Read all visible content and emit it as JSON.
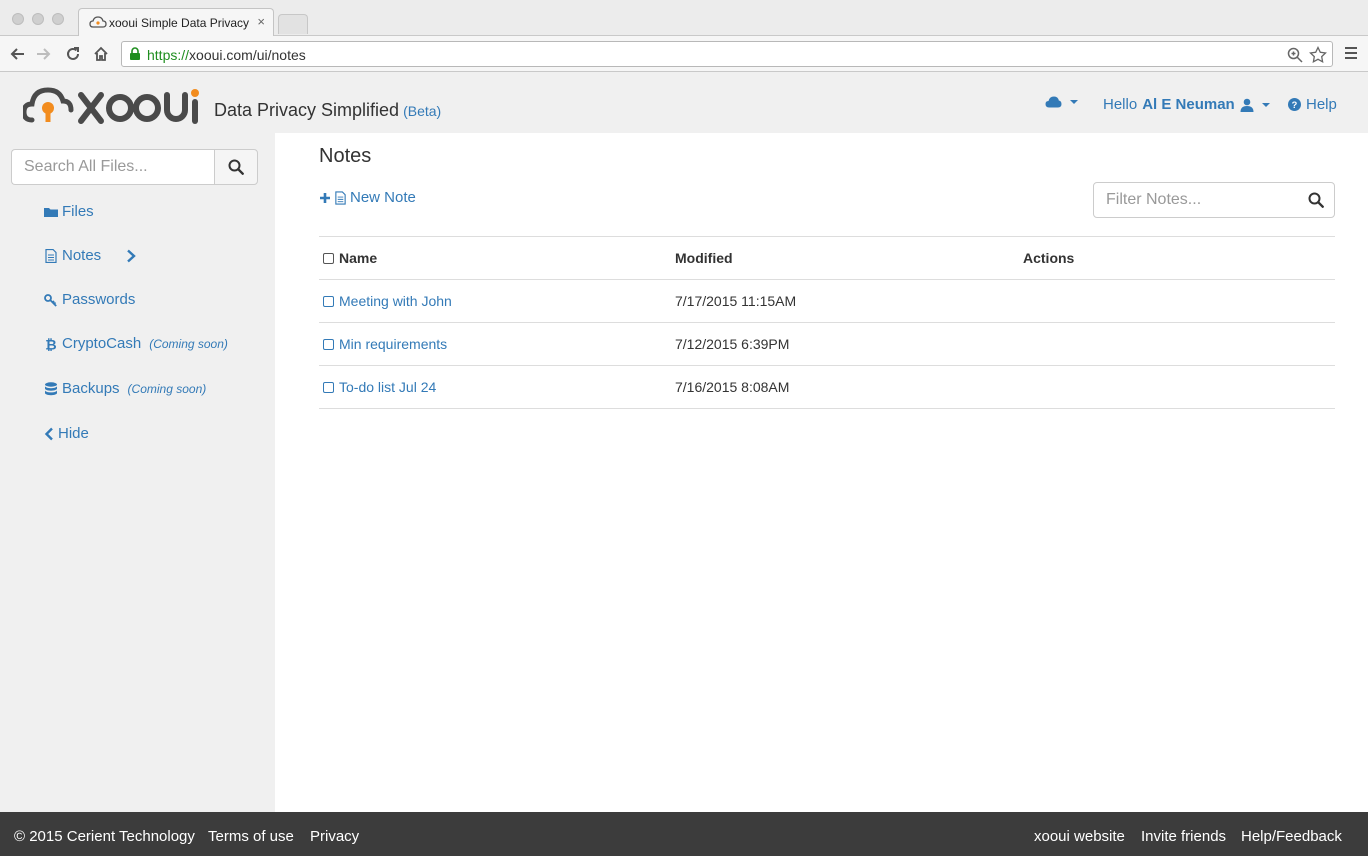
{
  "browser": {
    "tab_title": "xooui Simple Data Privacy",
    "tab_close": "×",
    "url_scheme": "https://",
    "url_rest": "xooui.com/ui/notes"
  },
  "header": {
    "tagline": "Data Privacy Simplified",
    "beta": "(Beta)",
    "greeting": "Hello",
    "user_name": "Al E Neuman",
    "help": "Help"
  },
  "sidebar": {
    "search_placeholder": "Search All Files...",
    "items": [
      {
        "label": "Files",
        "note": ""
      },
      {
        "label": "Notes",
        "note": ""
      },
      {
        "label": "Passwords",
        "note": ""
      },
      {
        "label": "CryptoCash",
        "note": "(Coming soon)"
      },
      {
        "label": "Backups",
        "note": "(Coming soon)"
      },
      {
        "label": "Hide",
        "note": ""
      }
    ]
  },
  "main": {
    "title": "Notes",
    "new_note": "New Note",
    "filter_placeholder": "Filter Notes...",
    "columns": [
      "Name",
      "Modified",
      "Actions"
    ],
    "rows": [
      {
        "name": "Meeting with John",
        "modified": "7/17/2015 11:15AM"
      },
      {
        "name": "Min requirements",
        "modified": "7/12/2015 6:39PM"
      },
      {
        "name": "To-do list Jul 24",
        "modified": "7/16/2015 8:08AM"
      }
    ]
  },
  "footer": {
    "copyright": "© 2015 Cerient Technology",
    "terms": "Terms of use",
    "privacy": "Privacy",
    "website": "xooui website",
    "invite": "Invite friends",
    "help_feedback": "Help/Feedback"
  },
  "colors": {
    "link": "#337ab7",
    "footer_bg": "#3c3c3c",
    "sidebar_bg": "#f0f0f0",
    "logo_orange": "#f28c1e",
    "logo_gray": "#4a4a4a",
    "secure_green": "#1f8e1f"
  }
}
